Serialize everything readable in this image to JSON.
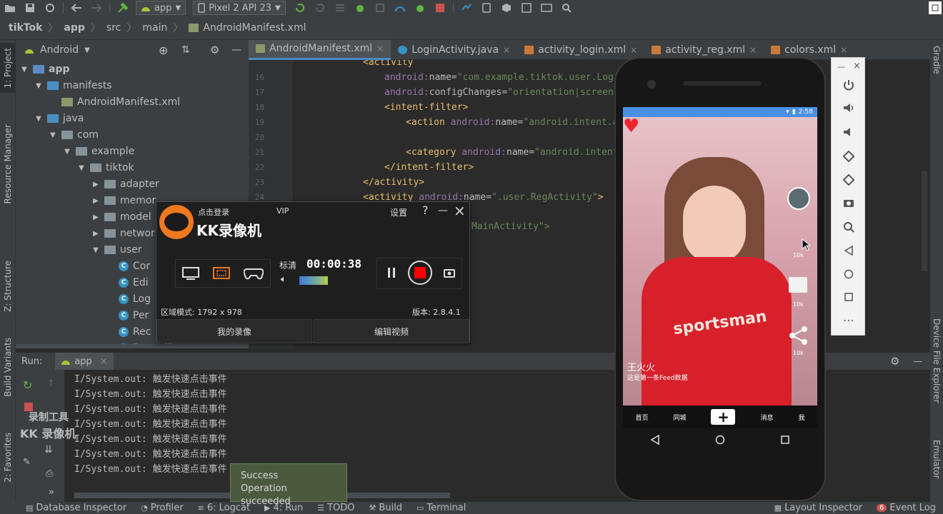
{
  "toolbar": {
    "config": "app",
    "device": "Pixel 2 API 23"
  },
  "breadcrumb": [
    "tikTok",
    "app",
    "src",
    "main",
    "AndroidManifest.xml"
  ],
  "project": {
    "view": "Android",
    "tree": [
      {
        "label": "app",
        "depth": 0,
        "kind": "module",
        "expanded": true
      },
      {
        "label": "manifests",
        "depth": 1,
        "kind": "folder",
        "expanded": true
      },
      {
        "label": "AndroidManifest.xml",
        "depth": 2,
        "kind": "manifest"
      },
      {
        "label": "java",
        "depth": 1,
        "kind": "folder",
        "expanded": true
      },
      {
        "label": "com",
        "depth": 2,
        "kind": "package",
        "expanded": true
      },
      {
        "label": "example",
        "depth": 3,
        "kind": "package",
        "expanded": true
      },
      {
        "label": "tiktok",
        "depth": 4,
        "kind": "package",
        "expanded": true
      },
      {
        "label": "adapter",
        "depth": 5,
        "kind": "package",
        "expanded": false
      },
      {
        "label": "memor",
        "depth": 5,
        "kind": "package",
        "expanded": false
      },
      {
        "label": "model",
        "depth": 5,
        "kind": "package",
        "expanded": false
      },
      {
        "label": "networ",
        "depth": 5,
        "kind": "package",
        "expanded": false
      },
      {
        "label": "user",
        "depth": 5,
        "kind": "package",
        "expanded": true
      },
      {
        "label": "Cor",
        "depth": 6,
        "kind": "class"
      },
      {
        "label": "Edi",
        "depth": 6,
        "kind": "class"
      },
      {
        "label": "Log",
        "depth": 6,
        "kind": "class"
      },
      {
        "label": "Per",
        "depth": 6,
        "kind": "class"
      },
      {
        "label": "Rec",
        "depth": 6,
        "kind": "class"
      },
      {
        "label": "RecordDao",
        "depth": 6,
        "kind": "class"
      }
    ]
  },
  "editor": {
    "tabs": [
      {
        "label": "AndroidManifest.xml",
        "active": true
      },
      {
        "label": "LoginActivity.java",
        "active": false
      },
      {
        "label": "activity_login.xml",
        "active": false
      },
      {
        "label": "activity_reg.xml",
        "active": false
      },
      {
        "label": "colors.xml",
        "active": false
      }
    ],
    "line_numbers": [
      "16",
      "17",
      "18",
      "19",
      "20",
      "21",
      "22",
      "23",
      "24"
    ],
    "code": [
      {
        "indent": 4,
        "parts": [
          [
            "tg",
            "<activity"
          ]
        ]
      },
      {
        "indent": 8,
        "parts": [
          [
            "an",
            "android:"
          ],
          [
            "at",
            "name="
          ],
          [
            "av",
            "\"com.example.tiktok.user.LoginActiv"
          ]
        ]
      },
      {
        "indent": 8,
        "parts": [
          [
            "an",
            "android:"
          ],
          [
            "at",
            "configChanges="
          ],
          [
            "av",
            "\"orientation|screenSize\""
          ],
          [
            "tg",
            ">"
          ]
        ]
      },
      {
        "indent": 8,
        "parts": [
          [
            "tg",
            "<intent-filter>"
          ]
        ]
      },
      {
        "indent": 12,
        "parts": [
          [
            "tg",
            "<action "
          ],
          [
            "an",
            "android:"
          ],
          [
            "at",
            "name="
          ],
          [
            "av",
            "\"android.intent.action."
          ]
        ]
      },
      {
        "indent": 0,
        "parts": []
      },
      {
        "indent": 12,
        "parts": [
          [
            "tg",
            "<category "
          ],
          [
            "an",
            "android:"
          ],
          [
            "at",
            "name="
          ],
          [
            "av",
            "\"android.intent.categ"
          ]
        ]
      },
      {
        "indent": 8,
        "parts": [
          [
            "tg",
            "</intent-filter>"
          ]
        ]
      },
      {
        "indent": 4,
        "parts": [
          [
            "tg",
            "</activity>"
          ]
        ]
      },
      {
        "indent": 4,
        "parts": [
          [
            "tg",
            "<activity "
          ],
          [
            "an",
            "android:"
          ],
          [
            "at",
            "name="
          ],
          [
            "av",
            "\".user.RegActivity\""
          ],
          [
            "tg",
            ">"
          ]
        ]
      }
    ],
    "hidden_line": "MainActivity\">"
  },
  "run": {
    "label": "Run:",
    "config": "app",
    "lines": [
      "I/System.out: 触发快速点击事件",
      "I/System.out: 触发快速点击事件",
      "I/System.out: 触发快速点击事件",
      "I/System.out: 触发快速点击事件",
      "I/System.out: 触发快速点击事件",
      "I/System.out: 触发快速点击事件",
      "I/System.out: 触发快速点击事件"
    ]
  },
  "watermark": {
    "line1": "录制工具",
    "line2": "KK 录像机"
  },
  "toast": {
    "title": "Success",
    "message": "Operation succeeded"
  },
  "kk": {
    "login": "点击登录",
    "vip": "VIP",
    "settings": "设置",
    "help": "?",
    "title": "KK录像机",
    "quality": "标清",
    "time": "00:00:38",
    "region": "区域模式: 1792 x 978",
    "version": "版本: 2.8.4.1",
    "my_recordings": "我的录像",
    "edit_video": "编辑视频"
  },
  "status": [
    {
      "label": "Database Inspector",
      "icon": "database-icon"
    },
    {
      "label": "Profiler",
      "icon": "gauge-icon"
    },
    {
      "label": "6: Logcat",
      "icon": "logcat-icon"
    },
    {
      "label": "4: Run",
      "icon": "run-icon"
    },
    {
      "label": "TODO",
      "icon": "list-icon"
    },
    {
      "label": "Build",
      "icon": "hammer-icon"
    },
    {
      "label": "Terminal",
      "icon": "terminal-icon"
    }
  ],
  "status_right": [
    {
      "label": "Layout Inspector",
      "icon": "layout-icon"
    },
    {
      "label": "Event Log",
      "icon": "event-icon",
      "badge": "6"
    }
  ],
  "left_tabs": [
    "1: Project",
    "Resource Manager",
    "Z: Structure",
    "Build Variants",
    "2: Favorites"
  ],
  "right_tabs": [
    "Gradle",
    "Device File Explorer",
    "Emulator"
  ],
  "phone": {
    "time": "2:58",
    "username": "王火火",
    "caption": "这是第一条Feed数据",
    "like_count": "10k",
    "comment_count": "10k",
    "share_count": "10k",
    "shirt_text": "sportsman",
    "nav": [
      "首页",
      "同城",
      "+",
      "消息",
      "我"
    ]
  },
  "colors": {
    "accent": "#4a88c7",
    "record": "#ff0000",
    "kk_orange": "#f0781e"
  }
}
